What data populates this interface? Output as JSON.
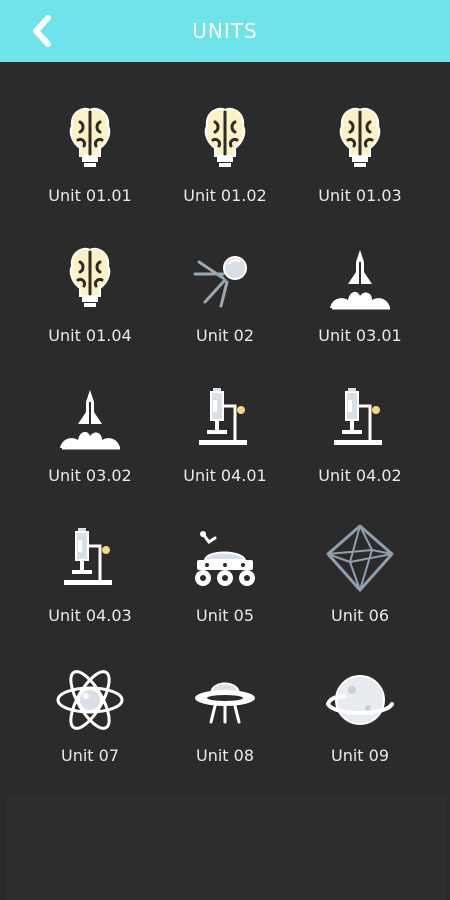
{
  "header": {
    "title": "UNITS",
    "back_icon": "chevron-left-icon",
    "bg_color": "#6fe3ea"
  },
  "units": [
    {
      "label": "Unit 01.01",
      "icon": "brain-bulb-icon"
    },
    {
      "label": "Unit 01.02",
      "icon": "brain-bulb-icon"
    },
    {
      "label": "Unit 01.03",
      "icon": "brain-bulb-icon"
    },
    {
      "label": "Unit 01.04",
      "icon": "brain-bulb-icon"
    },
    {
      "label": "Unit 02",
      "icon": "satellite-icon"
    },
    {
      "label": "Unit 03.01",
      "icon": "rocket-launch-icon"
    },
    {
      "label": "Unit 03.02",
      "icon": "rocket-launch-icon"
    },
    {
      "label": "Unit 04.01",
      "icon": "microscope-icon"
    },
    {
      "label": "Unit 04.02",
      "icon": "microscope-icon"
    },
    {
      "label": "Unit 04.03",
      "icon": "microscope-icon"
    },
    {
      "label": "Unit 05",
      "icon": "rover-icon"
    },
    {
      "label": "Unit 06",
      "icon": "octahedron-icon"
    },
    {
      "label": "Unit 07",
      "icon": "atom-icon"
    },
    {
      "label": "Unit 08",
      "icon": "ufo-icon"
    },
    {
      "label": "Unit 09",
      "icon": "planet-icon"
    }
  ]
}
